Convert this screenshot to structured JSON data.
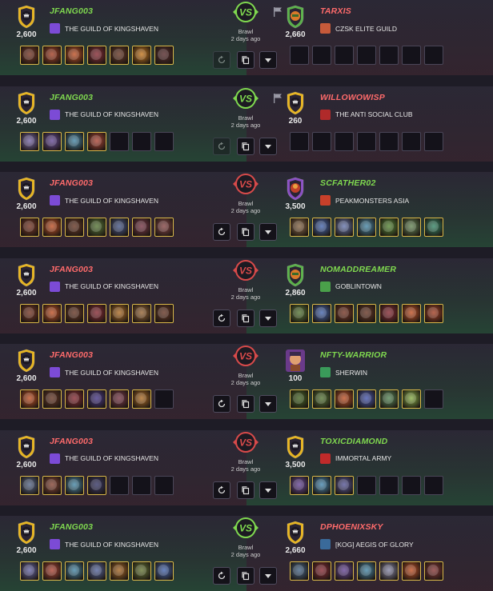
{
  "colors": {
    "win": "#7fd84f",
    "lose": "#ff6b6b",
    "card_border": "#d9b84a",
    "gold": "#e6b422",
    "green_shield": "#5bb04a",
    "purple_shield": "#8a4fc2",
    "vs_win": "#7fd84f",
    "vs_lose": "#d74a4a"
  },
  "battles": [
    {
      "result": "win",
      "left": {
        "name": "JFANG003",
        "rating": "2,600",
        "guild": "THE GUILD OF KINGSHAVEN",
        "avatar": "gold-shield-icon",
        "crest_color": "#7c4bd6",
        "outcome": "win",
        "cards": [
          "#7a3b2a",
          "#a8452a",
          "#c2552a",
          "#8a2f38",
          "#6a3b2a",
          "#c77a22",
          "#5a2f30"
        ]
      },
      "right": {
        "name": "TARXIS",
        "rating": "2,660",
        "guild": "CZSK ELITE GUILD",
        "avatar": "orc-shield-icon",
        "crest_color": "#c65a3a",
        "outcome": "lose",
        "cards": [
          null,
          null,
          null,
          null,
          null,
          null,
          null
        ]
      },
      "format": "Brawl",
      "time": "2 days ago",
      "flag": true,
      "rewatch_disabled": true
    },
    {
      "result": "win",
      "left": {
        "name": "JFANG003",
        "rating": "2,600",
        "guild": "THE GUILD OF KINGSHAVEN",
        "avatar": "gold-shield-icon",
        "crest_color": "#7c4bd6",
        "outcome": "win",
        "cards": [
          "#7a6aa8",
          "#6a4f9a",
          "#4a8aa8",
          "#b04a3a",
          null,
          null,
          null
        ]
      },
      "right": {
        "name": "WILLOWOWISP",
        "rating": "260",
        "guild": "THE ANTI SOCIAL CLUB",
        "avatar": "gold-shield-icon",
        "crest_color": "#b02a2a",
        "outcome": "lose",
        "cards": [
          null,
          null,
          null,
          null,
          null,
          null,
          null
        ]
      },
      "format": "Brawl",
      "time": "2 days ago",
      "flag": true,
      "rewatch_disabled": true
    },
    {
      "result": "lose",
      "left": {
        "name": "JFANG003",
        "rating": "2,600",
        "guild": "THE GUILD OF KINGSHAVEN",
        "avatar": "gold-shield-icon",
        "crest_color": "#7c4bd6",
        "outcome": "lose",
        "cards": [
          "#7a3b2a",
          "#c2552a",
          "#6a3b2a",
          "#5a7a3a",
          "#4a5a8a",
          "#7a3b4a",
          "#8a4a4a"
        ]
      },
      "right": {
        "name": "SCFATHER02",
        "rating": "3,500",
        "guild": "PEAKMONSTERS ASIA",
        "avatar": "purple-shield-icon",
        "crest_color": "#c8402a",
        "outcome": "win",
        "cards": [
          "#8a6a4a",
          "#4a6ab0",
          "#6a7ab0",
          "#4a8aa8",
          "#5a8a3a",
          "#6a8a5a",
          "#3a8a6a"
        ]
      },
      "format": "Brawl",
      "time": "2 days ago",
      "flag": false,
      "rewatch_disabled": false
    },
    {
      "result": "lose",
      "left": {
        "name": "JFANG003",
        "rating": "2,600",
        "guild": "THE GUILD OF KINGSHAVEN",
        "avatar": "gold-shield-icon",
        "crest_color": "#7c4bd6",
        "outcome": "lose",
        "cards": [
          "#7a3b2a",
          "#c2552a",
          "#6a3b2a",
          "#8a2f38",
          "#b0702a",
          "#9a6a3a",
          "#6a3b2a"
        ]
      },
      "right": {
        "name": "NOMADDREAMER",
        "rating": "2,860",
        "guild": "GOBLINTOWN",
        "avatar": "orc-shield-icon",
        "crest_color": "#4aa04a",
        "outcome": "win",
        "cards": [
          "#5a7a3a",
          "#4a6ab0",
          "#7a3b2a",
          "#6a3b2a",
          "#8a2f38",
          "#c2552a",
          "#a8452a"
        ]
      },
      "format": "Brawl",
      "time": "2 days ago",
      "flag": false,
      "rewatch_disabled": false
    },
    {
      "result": "lose",
      "left": {
        "name": "JFANG003",
        "rating": "2,600",
        "guild": "THE GUILD OF KINGSHAVEN",
        "avatar": "gold-shield-icon",
        "crest_color": "#7c4bd6",
        "outcome": "lose",
        "cards": [
          "#c2552a",
          "#6a3b2a",
          "#8a2f38",
          "#4a3a8a",
          "#7a3b4a",
          "#b0702a",
          null
        ]
      },
      "right": {
        "name": "NFTY-WARRIOR",
        "rating": "100",
        "guild": "SHERWIN",
        "avatar": "warrior-portrait-icon",
        "crest_color": "#3a9a5a",
        "outcome": "win",
        "cards": [
          "#4a6a2a",
          "#5a7a3a",
          "#c2552a",
          "#4a5ab0",
          "#5a8a5a",
          "#8ab04a",
          null
        ]
      },
      "format": "Brawl",
      "time": "2 days ago",
      "flag": false,
      "rewatch_disabled": false
    },
    {
      "result": "lose",
      "left": {
        "name": "JFANG003",
        "rating": "2,600",
        "guild": "THE GUILD OF KINGSHAVEN",
        "avatar": "gold-shield-icon",
        "crest_color": "#7c4bd6",
        "outcome": "lose",
        "cards": [
          "#5a6a8a",
          "#8a4a3a",
          "#4a8aa8",
          "#3a3a6a",
          null,
          null,
          null
        ]
      },
      "right": {
        "name": "TOXICDIAMOND",
        "rating": "3,500",
        "guild": "IMMORTAL ARMY",
        "avatar": "gold-shield-icon",
        "crest_color": "#c02a2a",
        "outcome": "win",
        "cards": [
          "#6a4a9a",
          "#4a8ab0",
          "#5a5a9a",
          null,
          null,
          null,
          null
        ]
      },
      "format": "Brawl",
      "time": "2 days ago",
      "flag": false,
      "rewatch_disabled": false
    },
    {
      "result": "win",
      "left": {
        "name": "JFANG003",
        "rating": "2,600",
        "guild": "THE GUILD OF KINGSHAVEN",
        "avatar": "gold-shield-icon",
        "crest_color": "#7c4bd6",
        "outcome": "win",
        "cards": [
          "#6a6aa8",
          "#b04a3a",
          "#4a8aa8",
          "#5a6aa0",
          "#a86a2a",
          "#6a7a3a",
          "#4a6ab0"
        ]
      },
      "right": {
        "name": "DPHOENIXSKY",
        "rating": "2,660",
        "guild": "[KOG] AEGIS OF GLORY",
        "avatar": "gold-shield-icon",
        "crest_color": "#3a6a9a",
        "outcome": "lose",
        "cards": [
          "#4a6a8a",
          "#8a2f38",
          "#6a4a9a",
          "#4a8aa8",
          "#8a8aa8",
          "#c2552a",
          "#8a3b3a"
        ]
      },
      "format": "Brawl",
      "time": "2 days ago",
      "flag": false,
      "rewatch_disabled": false
    }
  ]
}
